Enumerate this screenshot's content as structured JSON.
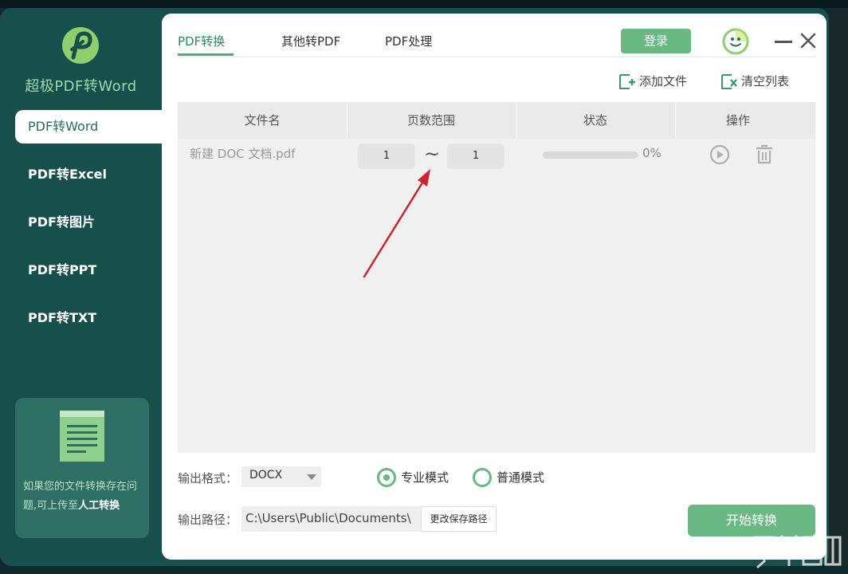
{
  "app": {
    "title": "超极PDF转Word",
    "accent_color": "#4cae78",
    "sidebar_color": "#164f4b"
  },
  "sidebar": {
    "items": [
      {
        "label": "PDF转Word",
        "active": true
      },
      {
        "label": "PDF转Excel"
      },
      {
        "label": "PDF转图片"
      },
      {
        "label": "PDF转PPT"
      },
      {
        "label": "PDF转TXT"
      }
    ],
    "help": {
      "text": "如果您的文件转换存在问题,可上传至",
      "emphasis": "人工转换"
    }
  },
  "header": {
    "tabs": [
      {
        "label": "PDF转换",
        "active": true
      },
      {
        "label": "其他转PDF"
      },
      {
        "label": "PDF处理"
      }
    ],
    "login_label": "登录"
  },
  "toolbar": {
    "add_file_label": "添加文件",
    "clear_list_label": "清空列表"
  },
  "table": {
    "columns": [
      "文件名",
      "页数范围",
      "状态",
      "操作"
    ],
    "rows": [
      {
        "filename": "新建 DOC 文档.pdf",
        "page_from": "1",
        "page_separator": "~",
        "page_to": "1",
        "progress": 0,
        "status_text": "0%"
      }
    ]
  },
  "output": {
    "format_label": "输出格式：",
    "format_value": "DOCX",
    "mode_pro_label": "专业模式",
    "mode_normal_label": "普通模式",
    "selected_mode": "pro",
    "path_label": "输出路径：",
    "path_value": "C:\\Users\\Public\\Documents\\",
    "change_path_label": "更改保存路径"
  },
  "start_label": "开始转换"
}
